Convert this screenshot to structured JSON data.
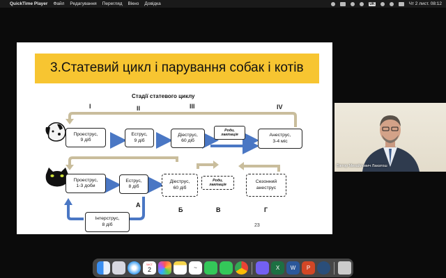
{
  "menubar": {
    "apple_icon": "",
    "app_name": "QuickTime Player",
    "menus": [
      "Файл",
      "Редагування",
      "Перегляд",
      "Вікно",
      "Довідка"
    ],
    "datetime": "Чт 2 лист.  08:12"
  },
  "slide": {
    "title": "3.Статевий цикл і парування собак і котів",
    "subtitle": "Стадії статевого циклу",
    "stages": [
      "I",
      "II",
      "III",
      "IV"
    ],
    "dog_row": {
      "proestrus": [
        "Проеструс,",
        "9 діб"
      ],
      "estrus": [
        "Еструс,",
        "9 діб"
      ],
      "diestrus": [
        "Діеструс,",
        "60 діб"
      ],
      "births": [
        "Роди,",
        "лактація"
      ],
      "anestrus": [
        "Анеструс,",
        "3-4 міс"
      ]
    },
    "cat_row": {
      "proestrus": [
        "Проеструс,",
        "1-3 доби"
      ],
      "estrus": [
        "Еструс,",
        "8 діб"
      ],
      "diestrus": [
        "Діеструс,",
        "60 діб"
      ],
      "births": [
        "Роди,",
        "лактація"
      ],
      "seasonal": [
        "Сезонний",
        "анеструс"
      ],
      "interestrus": [
        "Інтерструс,",
        "8 діб"
      ]
    },
    "letters": [
      "А",
      "Б",
      "В",
      "Г"
    ],
    "page_number": "23"
  },
  "video": {
    "participant_name": "Віктор Михайлович Лакатош"
  },
  "dock": {
    "calendar_month": "ЛИСТ.",
    "calendar_day": "2",
    "apps": [
      "finder-icon",
      "launchpad-icon",
      "safari-icon",
      "calendar-icon",
      "photos-icon",
      "notes-icon",
      "freeform-icon",
      "facetime-icon",
      "messages-icon",
      "chrome-icon",
      "viber-icon",
      "excel-icon",
      "word-icon",
      "powerpoint-icon",
      "quicktime-icon",
      "trash-icon"
    ]
  }
}
